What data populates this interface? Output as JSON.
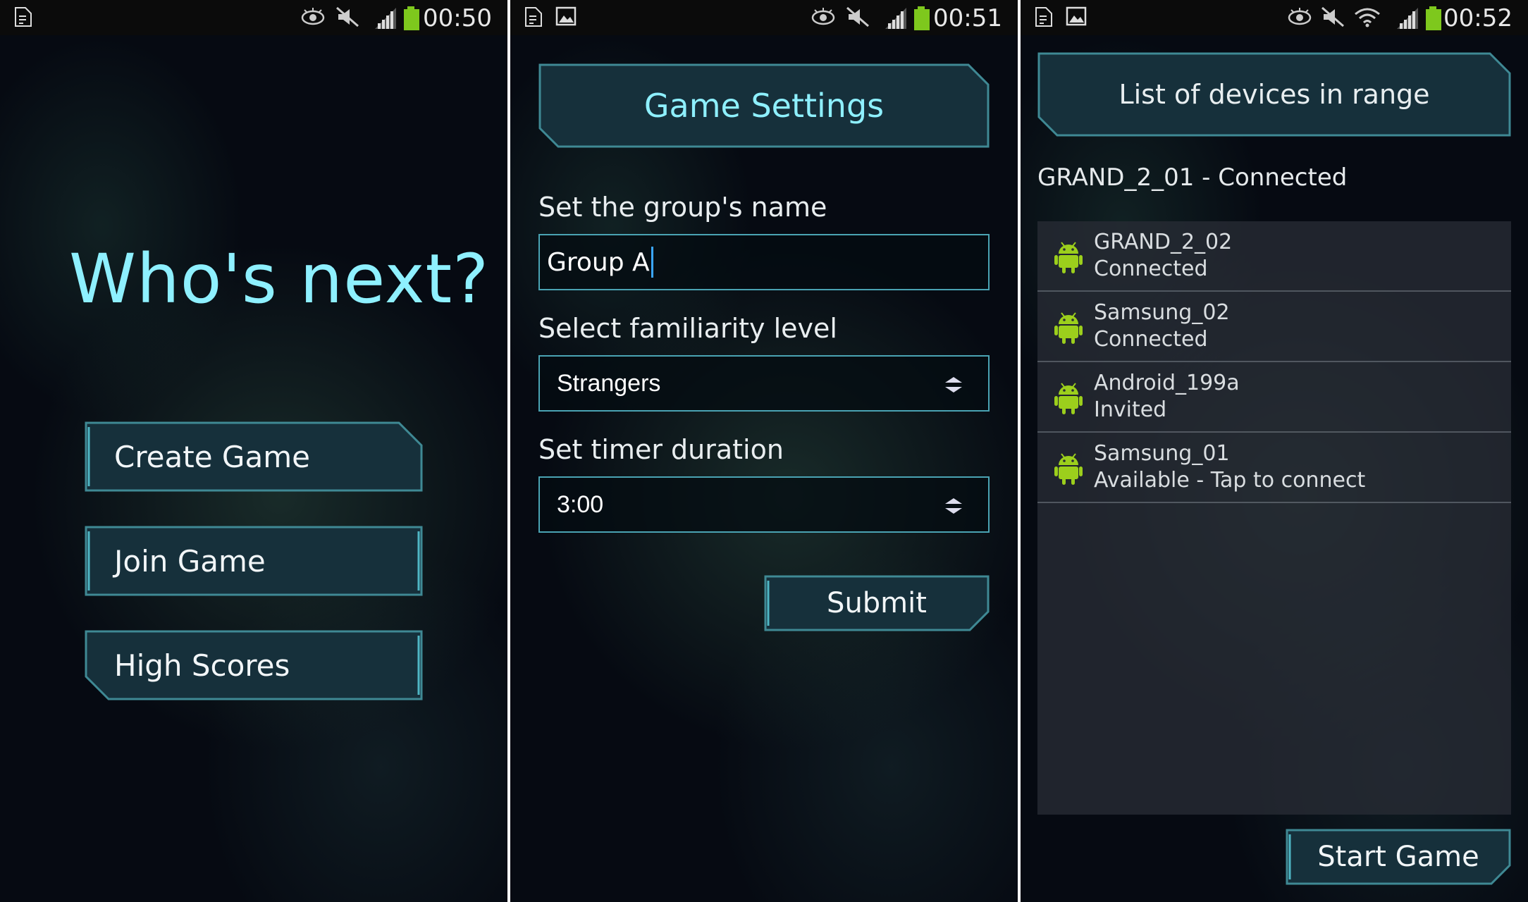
{
  "screens": [
    {
      "status_time": "00:50",
      "title": "Who's next?",
      "buttons": [
        "Create Game",
        "Join Game",
        "High Scores"
      ]
    },
    {
      "status_time": "00:51",
      "header": "Game Settings",
      "group_name_label": "Set the group's name",
      "group_name_value": "Group A",
      "familiarity_label": "Select familiarity level",
      "familiarity_value": "Strangers",
      "timer_label": "Set timer duration",
      "timer_value": "3:00",
      "submit_label": "Submit"
    },
    {
      "status_time": "00:52",
      "header": "List of devices in range",
      "self_status": "GRAND_2_01 - Connected",
      "devices": [
        {
          "name": "GRAND_2_02",
          "status": "Connected"
        },
        {
          "name": "Samsung_02",
          "status": "Connected"
        },
        {
          "name": "Android_199a",
          "status": "Invited"
        },
        {
          "name": "Samsung_01",
          "status": "Available - Tap to connect"
        }
      ],
      "start_label": "Start Game"
    }
  ],
  "icons": {
    "notification": "sim-card-icon",
    "picture": "picture-icon",
    "eye": "eye-icon",
    "mute": "mute-icon",
    "wifi": "wifi-icon",
    "signal": "signal-icon",
    "battery": "battery-icon",
    "device": "android-icon"
  },
  "colors": {
    "accent_cyan": "#8ef0ff",
    "panel_fill": "#16303b",
    "panel_border": "#3f8994",
    "battery_green": "#7ec81d",
    "android_green": "#9ccf1c"
  }
}
